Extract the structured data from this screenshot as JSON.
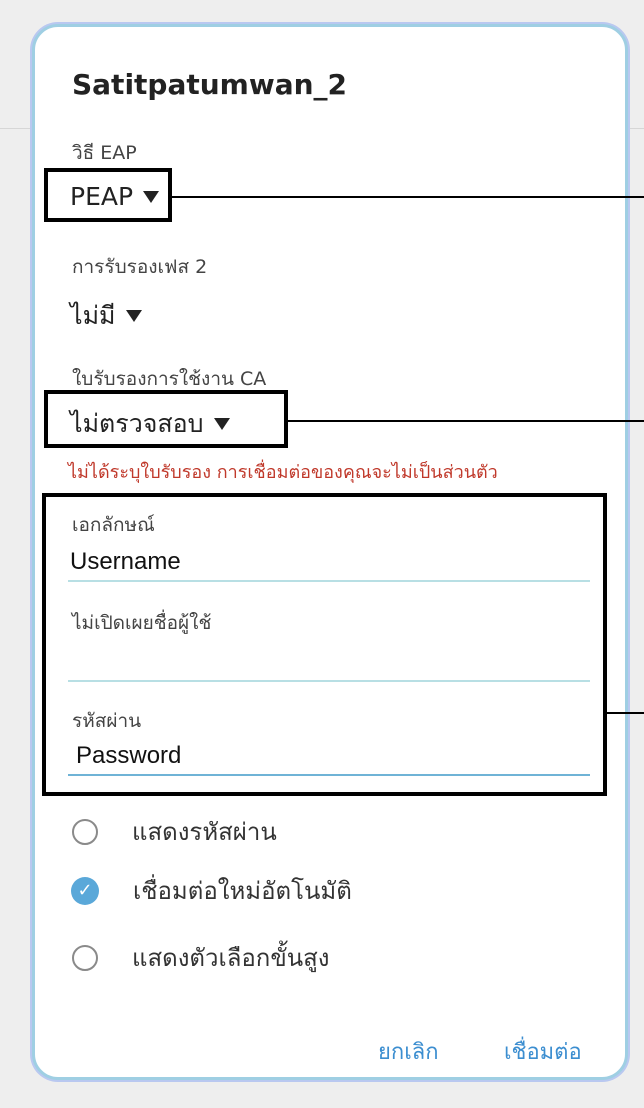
{
  "dialog": {
    "title": "Satitpatumwan_2",
    "eap_method": {
      "label": "วิธี EAP",
      "value": "PEAP"
    },
    "phase2": {
      "label": "การรับรองเฟส 2",
      "value": "ไม่มี"
    },
    "ca_cert": {
      "label": "ใบรับรองการใช้งาน CA",
      "value": "ไม่ตรวจสอบ"
    },
    "warning": "ไม่ได้ระบุใบรับรอง การเชื่อมต่อของคุณจะไม่เป็นส่วนตัว",
    "identity": {
      "label": "เอกลักษณ์",
      "value": "Username"
    },
    "anonymous_identity": {
      "label": "ไม่เปิดเผยชื่อผู้ใช้",
      "value": ""
    },
    "password": {
      "label": "รหัสผ่าน",
      "value": "Password"
    },
    "options": [
      {
        "label": "แสดงรหัสผ่าน",
        "checked": false
      },
      {
        "label": "เชื่อมต่อใหม่อัตโนมัติ",
        "checked": true
      },
      {
        "label": "แสดงตัวเลือกขั้นสูง",
        "checked": false
      }
    ],
    "cancel_label": "ยกเลิก",
    "connect_label": "เชื่อมต่อ"
  },
  "colors": {
    "accent": "#3c8ed0",
    "warning": "#c0392b",
    "checkbox": "#5aa8d9",
    "dialog_border": "#9fcfe3"
  }
}
